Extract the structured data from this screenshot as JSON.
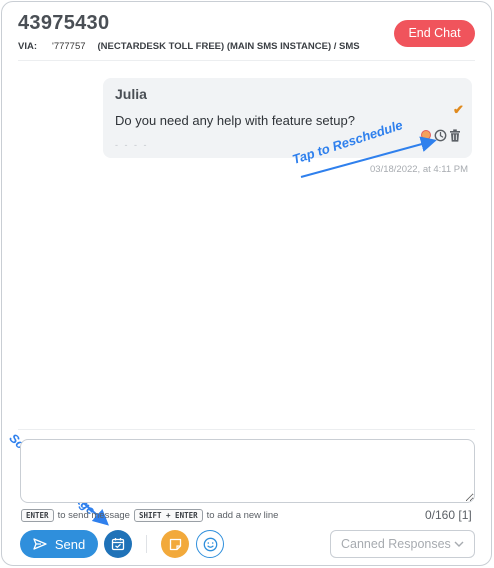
{
  "header": {
    "conversation_id": "43975430",
    "via_label": "VIA:",
    "via_number": "'777757",
    "via_channel": "(NECTARDESK TOLL FREE) (MAIN SMS INSTANCE) / SMS",
    "end_chat_label": "End Chat"
  },
  "message": {
    "sender": "Julia",
    "text": "Do you need any help with feature setup?",
    "placeholder_dots": "- - - -",
    "status": "sent",
    "timestamp": "03/18/2022, at 4:11 PM",
    "action_icons": [
      "emoji-icon",
      "clock-icon",
      "trash-icon"
    ]
  },
  "annotations": {
    "reschedule": "Tap to Reschedule",
    "schedule": "Schedule Message"
  },
  "composer": {
    "placeholder": "",
    "hint_enter_key": "ENTER",
    "hint_enter_text": "to send message",
    "hint_shift_key": "SHIFT + ENTER",
    "hint_shift_text": "to add a new line",
    "char_count": "0/160 [1]"
  },
  "toolbar": {
    "send_label": "Send",
    "canned_label": "Canned Responses"
  },
  "colors": {
    "end_chat": "#f0545c",
    "send": "#2f8fdc",
    "schedule": "#1f72b8",
    "note": "#f2a93b",
    "annotation": "#2f80ed",
    "check": "#e08a1e"
  }
}
